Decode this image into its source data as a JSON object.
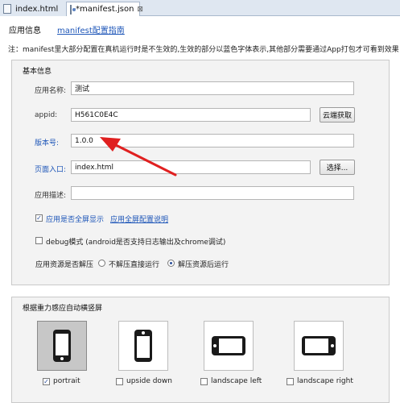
{
  "tabs": [
    {
      "label": "index.html",
      "icon": "html-file-icon"
    },
    {
      "label": "*manifest.json",
      "icon": "json-file-icon",
      "close": "⊠"
    }
  ],
  "subtabs": {
    "app_info": "应用信息",
    "manifest_guide": "manifest配置指南"
  },
  "notice": "注：manifest里大部分配置在真机运行时是不生效的,生效的部分以蓝色字体表示,其他部分需要通过App打包才可看到效果",
  "basic": {
    "title": "基本信息",
    "app_name_label": "应用名称:",
    "app_name_value": "测试",
    "appid_label": "appid:",
    "appid_value": "H561C0E4C",
    "cloud_button": "云端获取",
    "version_label": "版本号:",
    "version_value": "1.0.0",
    "entry_label": "页面入口:",
    "entry_value": "index.html",
    "choose_button": "选择...",
    "desc_label": "应用描述:",
    "desc_value": "",
    "fullscreen_label": "应用是否全屏显示",
    "fullscreen_link": "应用全屏配置说明",
    "debug_label": "debug模式 (android是否支持日志输出及chrome调试)",
    "unzip_label": "应用资源是否解压",
    "unzip_options": [
      "不解压直接运行",
      "解压资源后运行"
    ],
    "unzip_selected": "解压资源后运行"
  },
  "orientation": {
    "title": "根据重力感应自动横竖屏",
    "items": [
      {
        "label": "portrait",
        "checked": true
      },
      {
        "label": "upside down",
        "checked": false
      },
      {
        "label": "landscape left",
        "checked": false
      },
      {
        "label": "landscape right",
        "checked": false
      }
    ]
  },
  "colors": {
    "link": "#1e56b8",
    "annotation_arrow": "#e02020"
  }
}
